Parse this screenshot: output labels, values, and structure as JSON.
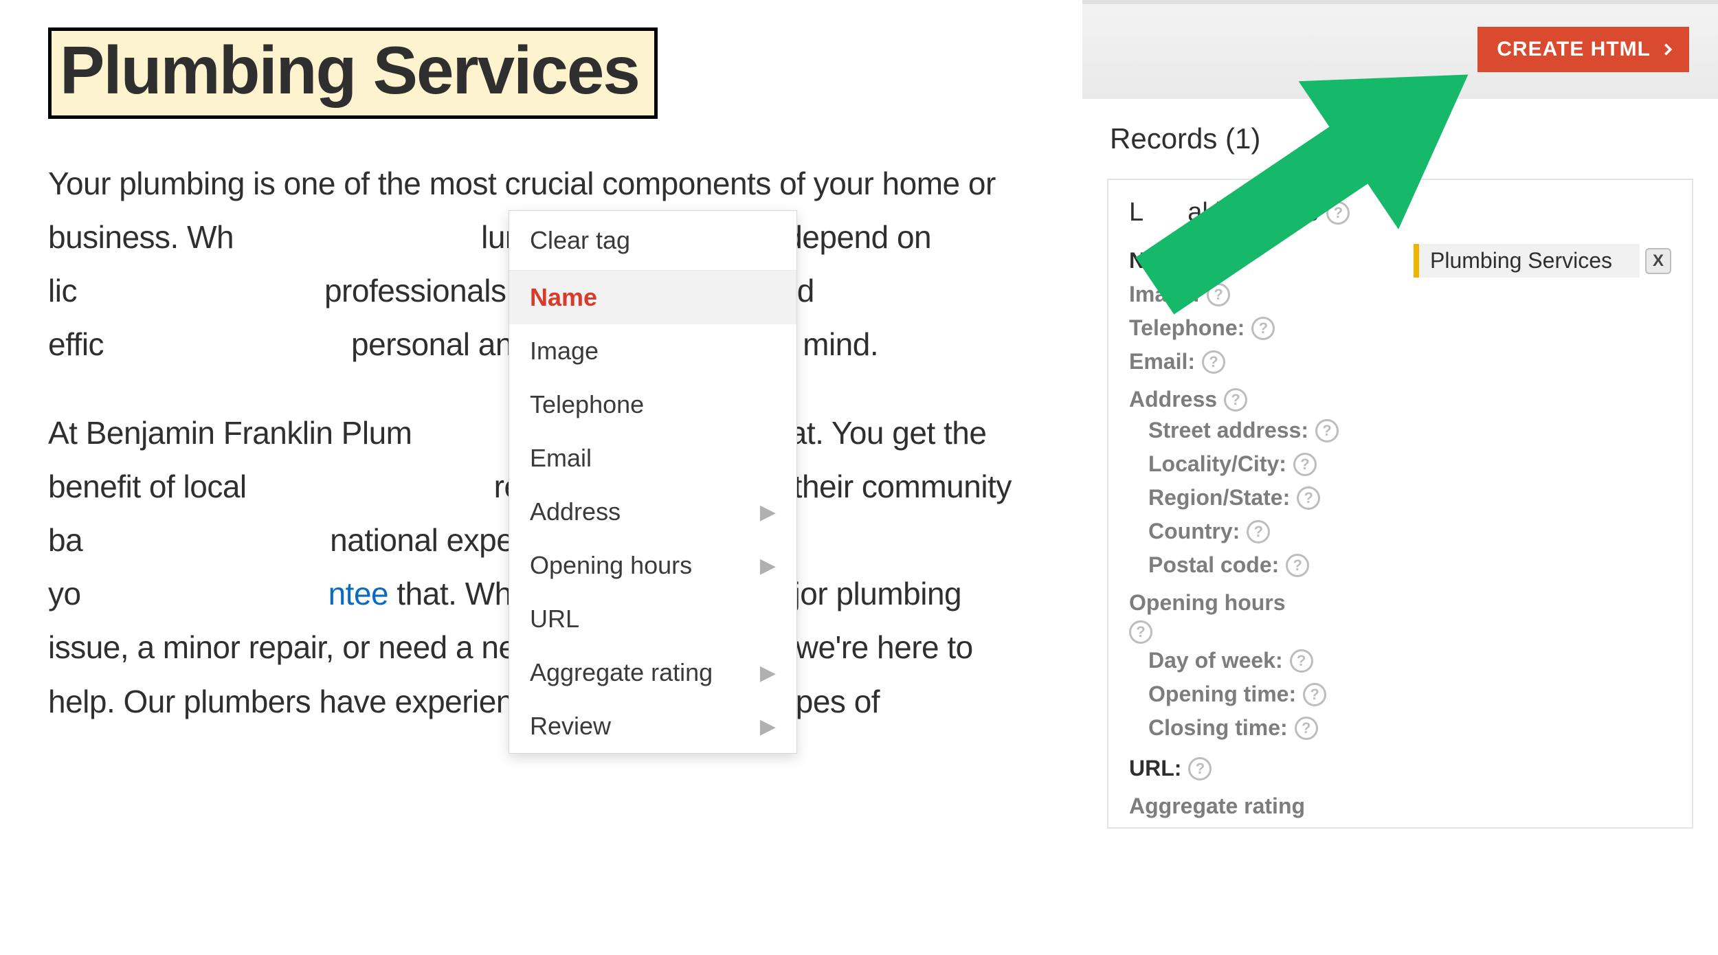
{
  "heading": "Plumbing Services",
  "partA": "Your plumbing is one of the most crucial components of your home or business. Wh",
  "partB": "lumbing problem, you depend on lic",
  "partC": "professionals to handle it safely and effic",
  "partD": "personal and home needs top of mind.",
  "p2a": "At Benjamin Franklin Plum",
  "p2b": "exactly that. You get the benefit of local",
  "p2c": "re invested in helping their community ba",
  "p2d": "national expertise. Our priority is yo",
  "p2link": "ntee",
  "p2e": " that. Whether you have a major plumbing issue, a minor repair, or need a new plumbing system, we're here to help. Our plumbers have experience working with all types of",
  "context_menu": {
    "clear": "Clear tag",
    "items": [
      {
        "label": "Name",
        "selected": true,
        "sub": false
      },
      {
        "label": "Image",
        "selected": false,
        "sub": false
      },
      {
        "label": "Telephone",
        "selected": false,
        "sub": false
      },
      {
        "label": "Email",
        "selected": false,
        "sub": false
      },
      {
        "label": "Address",
        "selected": false,
        "sub": true
      },
      {
        "label": "Opening hours",
        "selected": false,
        "sub": true
      },
      {
        "label": "URL",
        "selected": false,
        "sub": false
      },
      {
        "label": "Aggregate rating",
        "selected": false,
        "sub": true
      },
      {
        "label": "Review",
        "selected": false,
        "sub": true
      }
    ]
  },
  "sidebar": {
    "create_btn": "CREATE HTML",
    "records_label": "Records (1)",
    "card_title_prefix": "L",
    "card_title_rest": "al business",
    "name_label": "Name:",
    "name_value": "Plumbing Services",
    "image_label": "Image:",
    "telephone_label": "Telephone:",
    "email_label": "Email:",
    "address_label": "Address",
    "address_fields": {
      "street": "Street address:",
      "locality": "Locality/City:",
      "region": "Region/State:",
      "country": "Country:",
      "postal": "Postal code:"
    },
    "opening_label": "Opening hours",
    "opening_fields": {
      "day": "Day of week:",
      "open": "Opening time:",
      "close": "Closing time:"
    },
    "url_label": "URL:",
    "aggregate_label": "Aggregate rating"
  }
}
